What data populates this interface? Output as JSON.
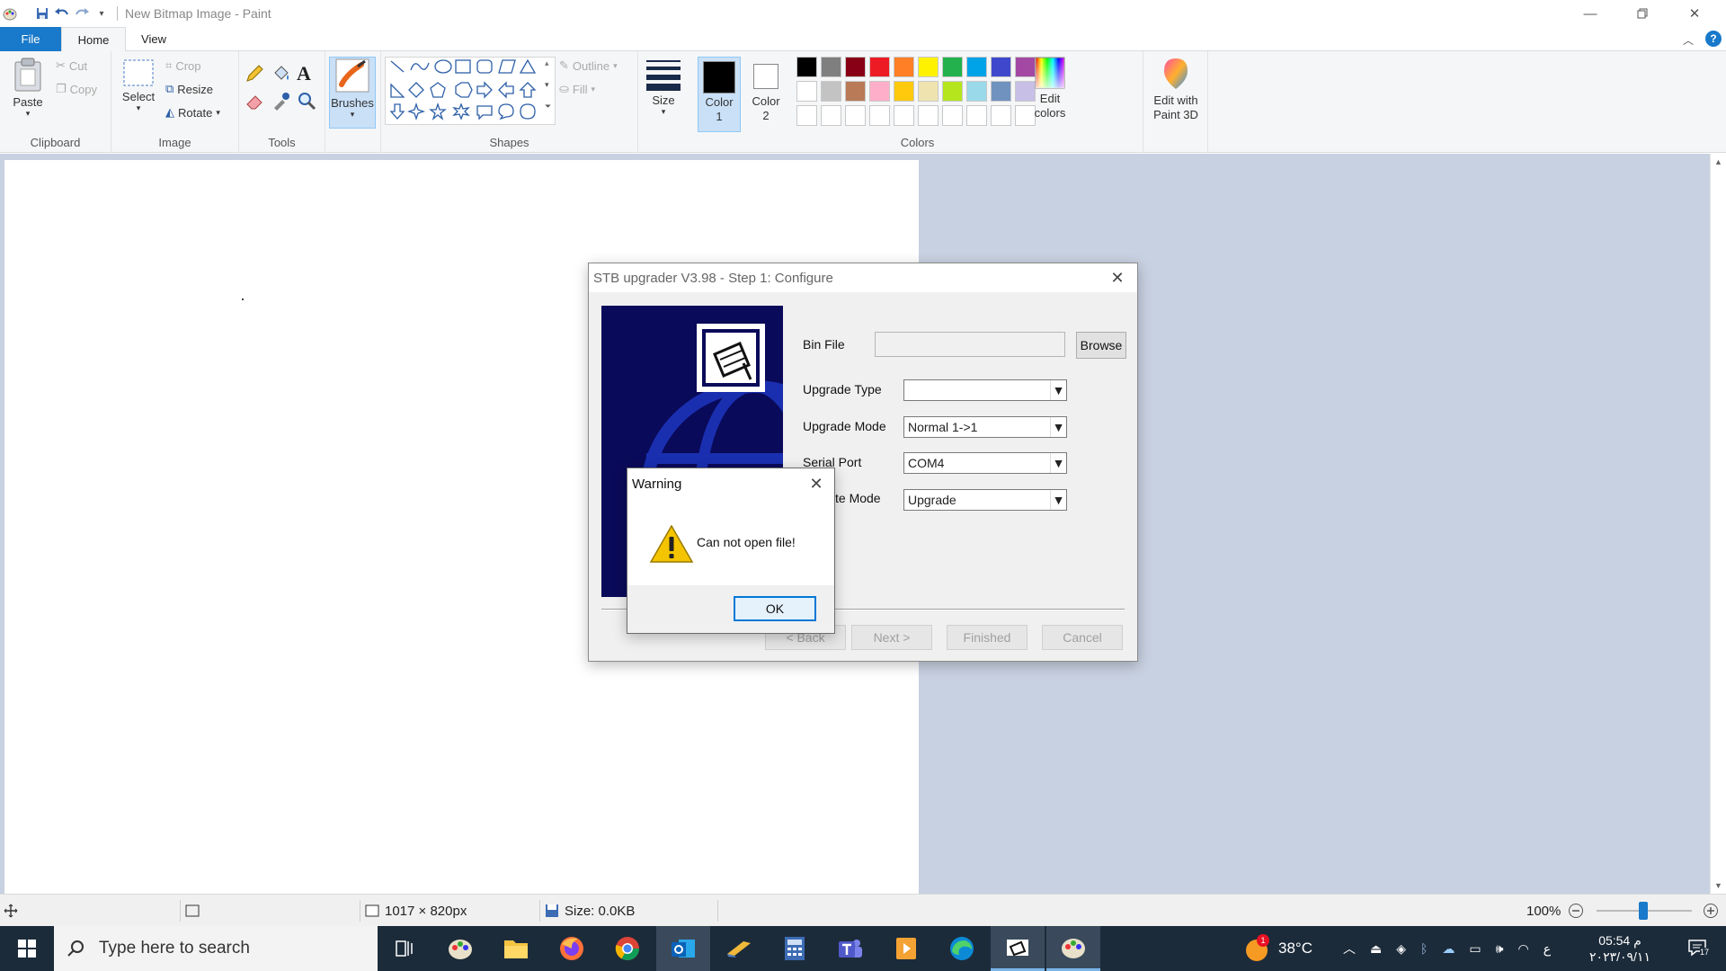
{
  "window": {
    "title": "New Bitmap Image - Paint"
  },
  "tabs": {
    "file": "File",
    "home": "Home",
    "view": "View"
  },
  "ribbon": {
    "clipboard": {
      "label": "Clipboard",
      "paste": "Paste",
      "cut": "Cut",
      "copy": "Copy"
    },
    "image": {
      "label": "Image",
      "select": "Select",
      "crop": "Crop",
      "resize": "Resize",
      "rotate": "Rotate"
    },
    "tools": {
      "label": "Tools"
    },
    "brushes": {
      "label": "Brushes"
    },
    "shapes": {
      "label": "Shapes",
      "outline": "Outline",
      "fill": "Fill"
    },
    "size": {
      "label": "Size"
    },
    "colors": {
      "label": "Colors",
      "color1": "Color\n1",
      "color2": "Color\n2",
      "color1_value": "#000000",
      "color2_value": "#ffffff",
      "edit_colors": "Edit\ncolors",
      "edit_paint3d": "Edit with\nPaint 3D",
      "palette_row1": [
        "#000000",
        "#7f7f7f",
        "#880015",
        "#ed1c24",
        "#ff7f27",
        "#fff200",
        "#22b14c",
        "#00a2e8",
        "#3f48cc",
        "#a349a4"
      ],
      "palette_row2": [
        "#ffffff",
        "#c3c3c3",
        "#b97a57",
        "#ffaec9",
        "#ffc90e",
        "#efe4b0",
        "#b5e61d",
        "#99d9ea",
        "#7092be",
        "#c8bfe7"
      ],
      "palette_row3": [
        "#ffffff",
        "#ffffff",
        "#ffffff",
        "#ffffff",
        "#ffffff",
        "#ffffff",
        "#ffffff",
        "#ffffff",
        "#ffffff",
        "#ffffff"
      ]
    }
  },
  "status": {
    "dimensions": "1017 × 820px",
    "size": "Size: 0.0KB",
    "zoom": "100%"
  },
  "taskbar": {
    "search_placeholder": "Type here to search",
    "temperature": "38°C",
    "time": "05:54 م",
    "date": "٢٠٢٣/٠٩/١١",
    "lang": "ع",
    "notification_count": "17",
    "weather_badge": "1"
  },
  "stb_dialog": {
    "title": "STB upgrader V3.98 - Step 1: Configure",
    "bin_file_label": "Bin File",
    "bin_file_value": "",
    "browse": "Browse",
    "upgrade_type_label": "Upgrade Type",
    "upgrade_type_value": "",
    "upgrade_mode_label": "Upgrade Mode",
    "upgrade_mode_value": "Normal 1->1",
    "serial_port_label": "Serial Port",
    "serial_port_value": "COM4",
    "update_mode_label": "te Mode",
    "update_mode_value": "Upgrade",
    "back": "< Back",
    "next": "Next >",
    "finished": "Finished",
    "cancel": "Cancel"
  },
  "warning_dialog": {
    "title": "Warning",
    "message": "Can not open file!",
    "ok": "OK"
  }
}
